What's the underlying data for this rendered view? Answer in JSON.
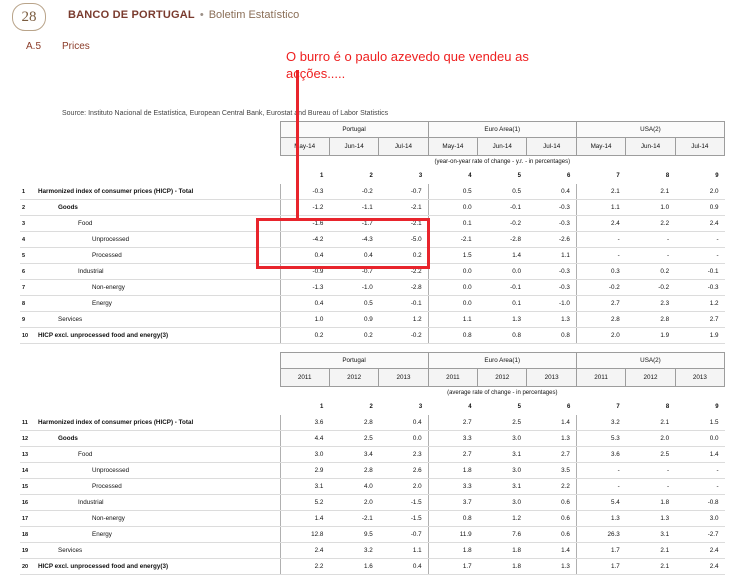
{
  "header": {
    "page_number": "28",
    "bank": "BANCO DE PORTUGAL",
    "separator": "•",
    "publication": "Boletim Estatístico"
  },
  "section": {
    "code": "A.5",
    "title": "Prices"
  },
  "annotation": "O burro é  o paulo azevedo que vendeu as acções.....",
  "source": "Source: Instituto Nacional de Estatística, European Central Bank, Eurostat and Bureau of Labor Statistics",
  "table1": {
    "groups": [
      "Portugal",
      "Euro Area(1)",
      "USA(2)"
    ],
    "periods": [
      "May-14",
      "Jun-14",
      "Jul-14",
      "May-14",
      "Jun-14",
      "Jul-14",
      "May-14",
      "Jun-14",
      "Jul-14"
    ],
    "note": "(year-on-year rate of change - y.r. - in percentages)",
    "col_numbers": [
      "1",
      "2",
      "3",
      "4",
      "5",
      "6",
      "7",
      "8",
      "9"
    ],
    "rows": [
      {
        "idx": "1",
        "label": "Harmonized index of consumer prices (HICP) - Total",
        "level": 0,
        "bold": true,
        "values": [
          "-0.3",
          "-0.2",
          "-0.7",
          "0.5",
          "0.5",
          "0.4",
          "2.1",
          "2.1",
          "2.0"
        ]
      },
      {
        "idx": "2",
        "label": "Goods",
        "level": 1,
        "bold": true,
        "values": [
          "-1.2",
          "-1.1",
          "-2.1",
          "0.0",
          "-0.1",
          "-0.3",
          "1.1",
          "1.0",
          "0.9"
        ]
      },
      {
        "idx": "3",
        "label": "Food",
        "level": 2,
        "bold": false,
        "values": [
          "-1.6",
          "-1.7",
          "-2.1",
          "0.1",
          "-0.2",
          "-0.3",
          "2.4",
          "2.2",
          "2.4"
        ]
      },
      {
        "idx": "4",
        "label": "Unprocessed",
        "level": 3,
        "bold": false,
        "values": [
          "-4.2",
          "-4.3",
          "-5.0",
          "-2.1",
          "-2.8",
          "-2.6",
          "-",
          "-",
          "-"
        ]
      },
      {
        "idx": "5",
        "label": "Processed",
        "level": 3,
        "bold": false,
        "values": [
          "0.4",
          "0.4",
          "0.2",
          "1.5",
          "1.4",
          "1.1",
          "-",
          "-",
          "-"
        ]
      },
      {
        "idx": "6",
        "label": "Industrial",
        "level": 2,
        "bold": false,
        "values": [
          "-0.9",
          "-0.7",
          "-2.2",
          "0.0",
          "0.0",
          "-0.3",
          "0.3",
          "0.2",
          "-0.1"
        ]
      },
      {
        "idx": "7",
        "label": "Non-energy",
        "level": 3,
        "bold": false,
        "values": [
          "-1.3",
          "-1.0",
          "-2.8",
          "0.0",
          "-0.1",
          "-0.3",
          "-0.2",
          "-0.2",
          "-0.3"
        ]
      },
      {
        "idx": "8",
        "label": "Energy",
        "level": 3,
        "bold": false,
        "values": [
          "0.4",
          "0.5",
          "-0.1",
          "0.0",
          "0.1",
          "-1.0",
          "2.7",
          "2.3",
          "1.2"
        ]
      },
      {
        "idx": "9",
        "label": "Services",
        "level": 1,
        "bold": false,
        "values": [
          "1.0",
          "0.9",
          "1.2",
          "1.1",
          "1.3",
          "1.3",
          "2.8",
          "2.8",
          "2.7"
        ]
      },
      {
        "idx": "10",
        "label": "HICP excl. unprocessed food and energy(3)",
        "level": 0,
        "bold": true,
        "values": [
          "0.2",
          "0.2",
          "-0.2",
          "0.8",
          "0.8",
          "0.8",
          "2.0",
          "1.9",
          "1.9"
        ]
      }
    ]
  },
  "table2": {
    "groups": [
      "Portugal",
      "Euro Area(1)",
      "USA(2)"
    ],
    "periods": [
      "2011",
      "2012",
      "2013",
      "2011",
      "2012",
      "2013",
      "2011",
      "2012",
      "2013"
    ],
    "note": "(average rate of change - in percentages)",
    "col_numbers": [
      "1",
      "2",
      "3",
      "4",
      "5",
      "6",
      "7",
      "8",
      "9"
    ],
    "rows": [
      {
        "idx": "11",
        "label": "Harmonized index of consumer prices (HICP) - Total",
        "level": 0,
        "bold": true,
        "values": [
          "3.6",
          "2.8",
          "0.4",
          "2.7",
          "2.5",
          "1.4",
          "3.2",
          "2.1",
          "1.5"
        ]
      },
      {
        "idx": "12",
        "label": "Goods",
        "level": 1,
        "bold": true,
        "values": [
          "4.4",
          "2.5",
          "0.0",
          "3.3",
          "3.0",
          "1.3",
          "5.3",
          "2.0",
          "0.0"
        ]
      },
      {
        "idx": "13",
        "label": "Food",
        "level": 2,
        "bold": false,
        "values": [
          "3.0",
          "3.4",
          "2.3",
          "2.7",
          "3.1",
          "2.7",
          "3.6",
          "2.5",
          "1.4"
        ]
      },
      {
        "idx": "14",
        "label": "Unprocessed",
        "level": 3,
        "bold": false,
        "values": [
          "2.9",
          "2.8",
          "2.6",
          "1.8",
          "3.0",
          "3.5",
          "-",
          "-",
          "-"
        ]
      },
      {
        "idx": "15",
        "label": "Processed",
        "level": 3,
        "bold": false,
        "values": [
          "3.1",
          "4.0",
          "2.0",
          "3.3",
          "3.1",
          "2.2",
          "-",
          "-",
          "-"
        ]
      },
      {
        "idx": "16",
        "label": "Industrial",
        "level": 2,
        "bold": false,
        "values": [
          "5.2",
          "2.0",
          "-1.5",
          "3.7",
          "3.0",
          "0.6",
          "5.4",
          "1.8",
          "-0.8"
        ]
      },
      {
        "idx": "17",
        "label": "Non-energy",
        "level": 3,
        "bold": false,
        "values": [
          "1.4",
          "-2.1",
          "-1.5",
          "0.8",
          "1.2",
          "0.6",
          "1.3",
          "1.3",
          "3.0"
        ]
      },
      {
        "idx": "18",
        "label": "Energy",
        "level": 3,
        "bold": false,
        "values": [
          "12.8",
          "9.5",
          "-0.7",
          "11.9",
          "7.6",
          "0.6",
          "26.3",
          "3.1",
          "-2.7"
        ]
      },
      {
        "idx": "19",
        "label": "Services",
        "level": 1,
        "bold": false,
        "values": [
          "2.4",
          "3.2",
          "1.1",
          "1.8",
          "1.8",
          "1.4",
          "1.7",
          "2.1",
          "2.4"
        ]
      },
      {
        "idx": "20",
        "label": "HICP excl. unprocessed food and energy(3)",
        "level": 0,
        "bold": true,
        "values": [
          "2.2",
          "1.6",
          "0.4",
          "1.7",
          "1.8",
          "1.3",
          "1.7",
          "2.1",
          "2.4"
        ]
      }
    ]
  }
}
